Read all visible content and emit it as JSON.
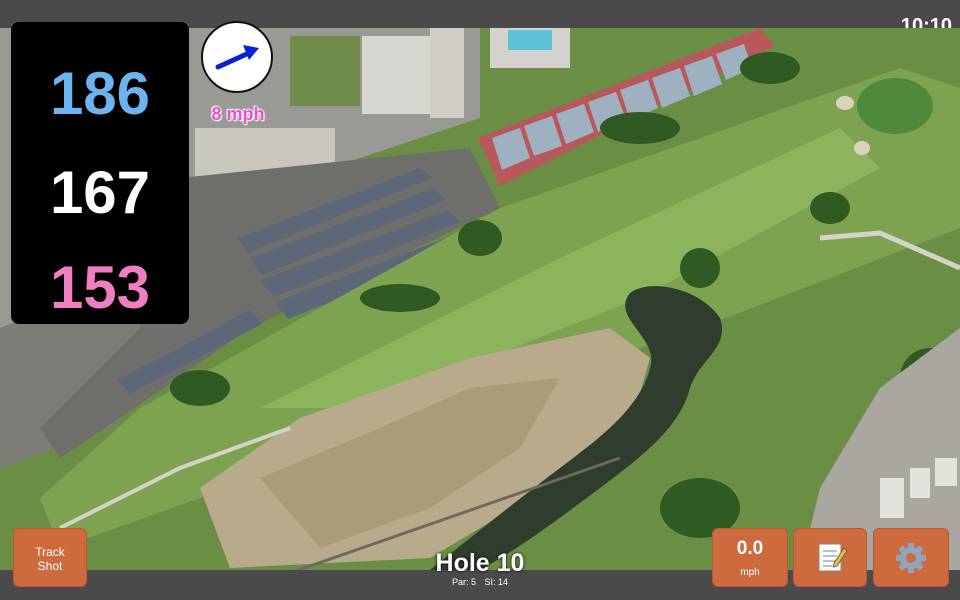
{
  "status_bar": {
    "time": "10:10"
  },
  "yardages": {
    "back": "186",
    "center": "167",
    "front": "153"
  },
  "wind": {
    "speed_label": "8 mph",
    "icon": "wind-direction-arrow-icon",
    "direction": "east-northeast"
  },
  "hole": {
    "title": "Hole 10",
    "par_label": "Par: 5",
    "si_label": "SI: 14"
  },
  "buttons": {
    "track_shot_line1": "Track",
    "track_shot_line2": "Shot",
    "speed_value": "0.0",
    "speed_unit": "mph",
    "notes_icon": "notepad-icon",
    "settings_icon": "gear-icon"
  },
  "colors": {
    "back_yardage": "#6cb4f0",
    "center_yardage": "#ffffff",
    "front_yardage": "#f07ec0",
    "wind_label": "#ea4fd1",
    "button_bg": "#cd6a3e",
    "bar_bg": "#4a4a4a"
  }
}
